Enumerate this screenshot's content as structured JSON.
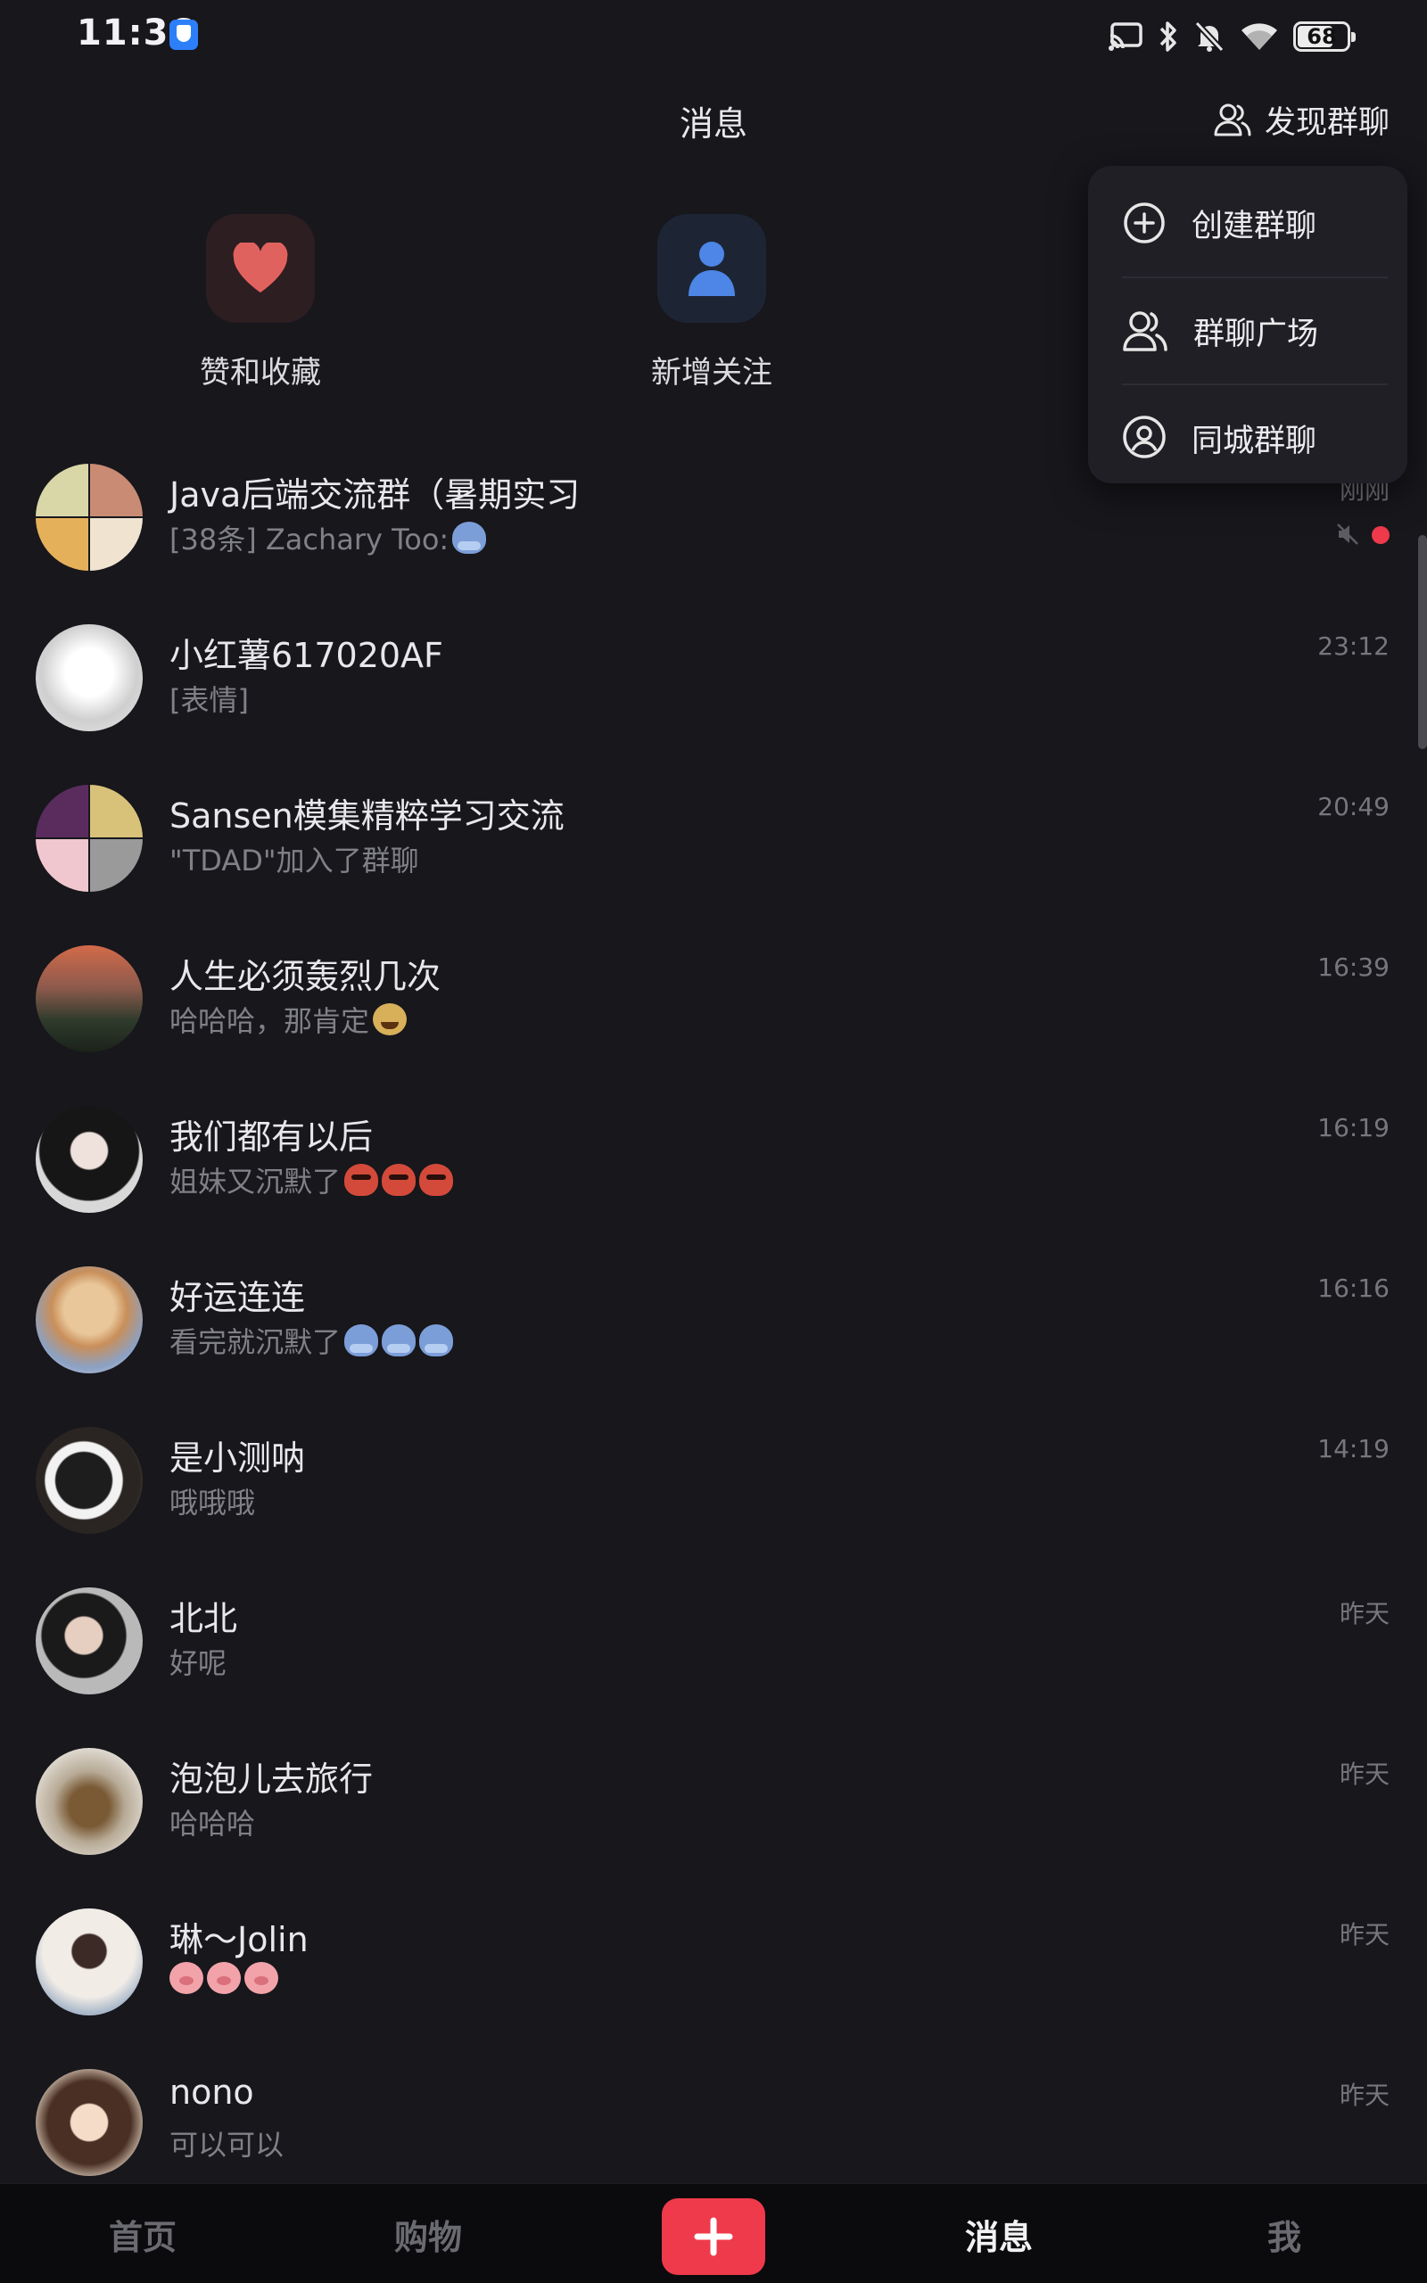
{
  "status_bar": {
    "time": "11:36",
    "battery_level": "68",
    "icons": [
      "shield-icon",
      "cast-icon",
      "bluetooth-icon",
      "mute-bell-icon",
      "wifi-icon",
      "battery-icon"
    ]
  },
  "header": {
    "title": "消息",
    "discover_label": "发现群聊"
  },
  "quick_actions": [
    {
      "label": "赞和收藏",
      "icon": "heart-icon",
      "color": "#e0625f"
    },
    {
      "label": "新增关注",
      "icon": "person-icon",
      "color": "#4d86e6"
    }
  ],
  "popup_menu": {
    "items": [
      {
        "label": "创建群聊",
        "icon": "plus-circle-icon"
      },
      {
        "label": "群聊广场",
        "icon": "users-icon"
      },
      {
        "label": "同城群聊",
        "icon": "location-icon"
      }
    ]
  },
  "conversations": [
    {
      "name": "Java后端交流群（暑期实习",
      "preview": "[38条] Zachary Too:",
      "time": "刚刚",
      "muted": true,
      "unread": true
    },
    {
      "name": "小红薯617020AF",
      "preview": "[表情]",
      "time": "23:12"
    },
    {
      "name": "Sansen模集精粹学习交流",
      "preview": "\"TDAD\"加入了群聊",
      "time": "20:49"
    },
    {
      "name": "人生必须轰烈几次",
      "preview": "哈哈哈，那肯定",
      "time": "16:39"
    },
    {
      "name": "我们都有以后",
      "preview": "姐妹又沉默了",
      "time": "16:19"
    },
    {
      "name": "好运连连",
      "preview": "看完就沉默了",
      "time": "16:16"
    },
    {
      "name": "是小测呐",
      "preview": "哦哦哦",
      "time": "14:19"
    },
    {
      "name": "北北",
      "preview": "好呢",
      "time": "昨天"
    },
    {
      "name": "泡泡儿去旅行",
      "preview": "哈哈哈",
      "time": "昨天"
    },
    {
      "name": "琳～Jolin",
      "preview": "",
      "time": "昨天"
    },
    {
      "name": "nono",
      "preview": "可以可以",
      "time": "昨天"
    }
  ],
  "bottom_nav": {
    "items": [
      "首页",
      "购物",
      "消息",
      "我"
    ],
    "active": "消息",
    "publish_icon": "plus-icon",
    "accent_color": "#ef3a4b"
  }
}
